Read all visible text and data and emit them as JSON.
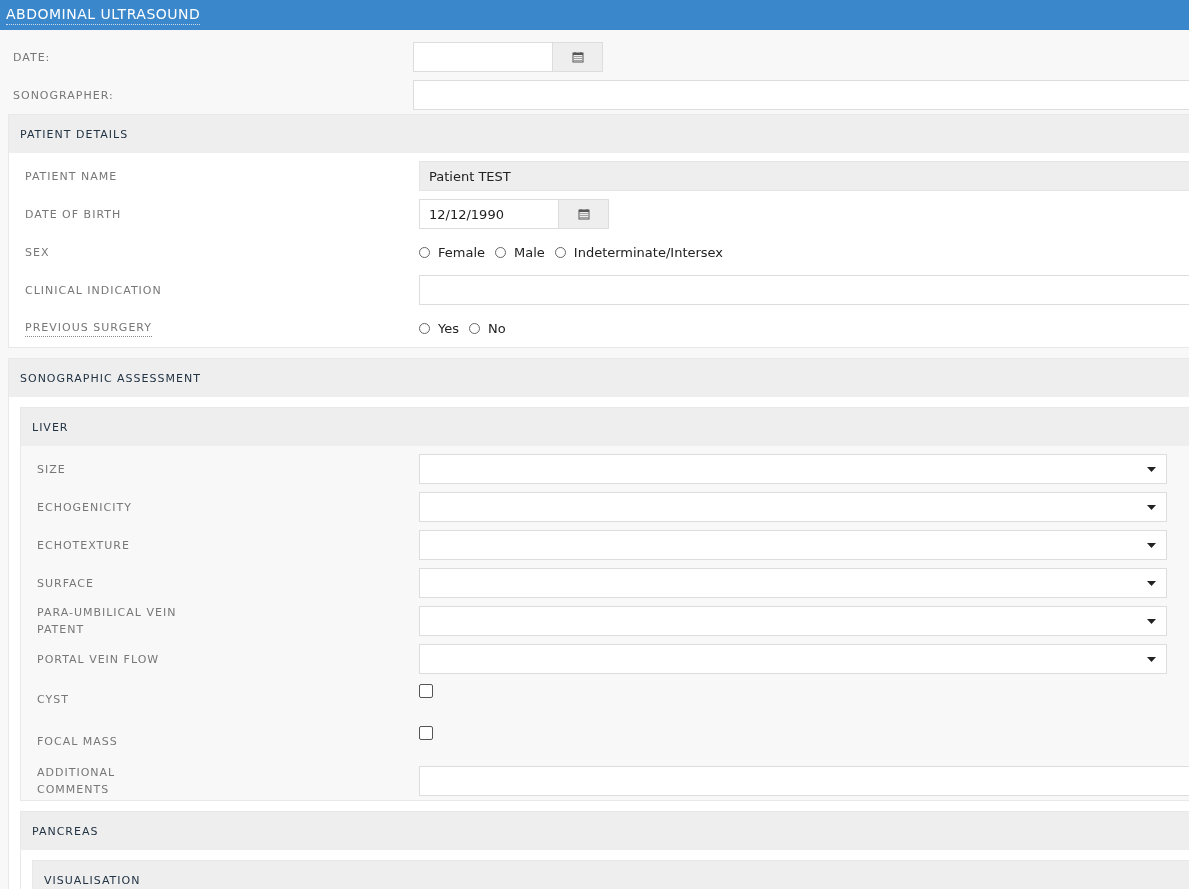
{
  "header": {
    "title": "ABDOMINAL ULTRASOUND",
    "hint": true
  },
  "fields": [
    {
      "kind": "date",
      "label": "DATE:"
    },
    {
      "kind": "text",
      "label": "SONOGRAPHER:"
    }
  ],
  "sections": [
    {
      "title": "PATIENT DETAILS",
      "fields": [
        {
          "kind": "readonly",
          "label": "PATIENT NAME",
          "value": "Patient TEST"
        },
        {
          "kind": "date",
          "label": "DATE OF BIRTH",
          "value": "12/12/1990"
        },
        {
          "kind": "radio",
          "label": "SEX",
          "options": [
            {
              "label": "Female",
              "selected": false
            },
            {
              "label": "Male",
              "selected": false
            },
            {
              "label": "Indeterminate/Intersex",
              "selected": false
            }
          ]
        },
        {
          "kind": "text",
          "label": "CLINICAL INDICATION"
        },
        {
          "kind": "radio",
          "label": "PREVIOUS SURGERY",
          "hint": true,
          "options": [
            {
              "label": "Yes",
              "selected": false
            },
            {
              "label": "No",
              "selected": false
            }
          ]
        }
      ]
    },
    {
      "title": "SONOGRAPHIC ASSESSMENT",
      "subsections": [
        {
          "title": "LIVER",
          "fields": [
            {
              "kind": "select",
              "label": "SIZE"
            },
            {
              "kind": "select",
              "label": "ECHOGENICITY"
            },
            {
              "kind": "select",
              "label": "ECHOTEXTURE"
            },
            {
              "kind": "select",
              "label": "SURFACE"
            },
            {
              "kind": "select",
              "label": "PARA-UMBILICAL VEIN PATENT"
            },
            {
              "kind": "select",
              "label": "PORTAL VEIN FLOW"
            },
            {
              "kind": "checkbox",
              "label": "CYST",
              "checked": false
            },
            {
              "kind": "checkbox",
              "label": "FOCAL MASS",
              "checked": false
            },
            {
              "kind": "text",
              "label": "ADDITIONAL COMMENTS"
            }
          ]
        },
        {
          "title": "PANCREAS",
          "subsections": [
            {
              "title": "VISUALISATION"
            }
          ]
        }
      ]
    }
  ]
}
